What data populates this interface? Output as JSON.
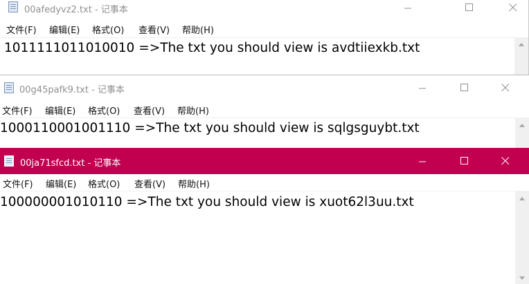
{
  "windows": [
    {
      "title": "00afedyvz2.txt - 记事本",
      "menu": [
        "文件(F)",
        "编辑(E)",
        "格式(O)",
        "查看(V)",
        "帮助(H)"
      ],
      "content": "1011111011010010 =>The txt you should view is avdtiiexkb.txt",
      "active": false
    },
    {
      "title": "00g45pafk9.txt - 记事本",
      "menu": [
        "文件(F)",
        "编辑(E)",
        "格式(O)",
        "查看(V)",
        "帮助(H)"
      ],
      "content": "1000110001001110 =>The txt you should view is sqlgsguybt.txt",
      "active": false
    },
    {
      "title": "00ja71sfcd.txt - 记事本",
      "menu": [
        "文件(F)",
        "编辑(E)",
        "格式(O)",
        "查看(V)",
        "帮助(H)"
      ],
      "content": "100000001010110 =>The txt you should view is xuot62l3uu.txt",
      "active": true
    }
  ],
  "colors": {
    "active_titlebar": "#c20050",
    "inactive_title_text": "#8f8f8f",
    "scrollbar": "#f0f0f0"
  },
  "icons": {
    "app": "notepad-icon",
    "minimize": "minimize-icon",
    "maximize": "maximize-icon",
    "close": "close-icon",
    "scroll_up": "scroll-up-arrow-icon",
    "scroll_down": "scroll-down-arrow-icon"
  }
}
